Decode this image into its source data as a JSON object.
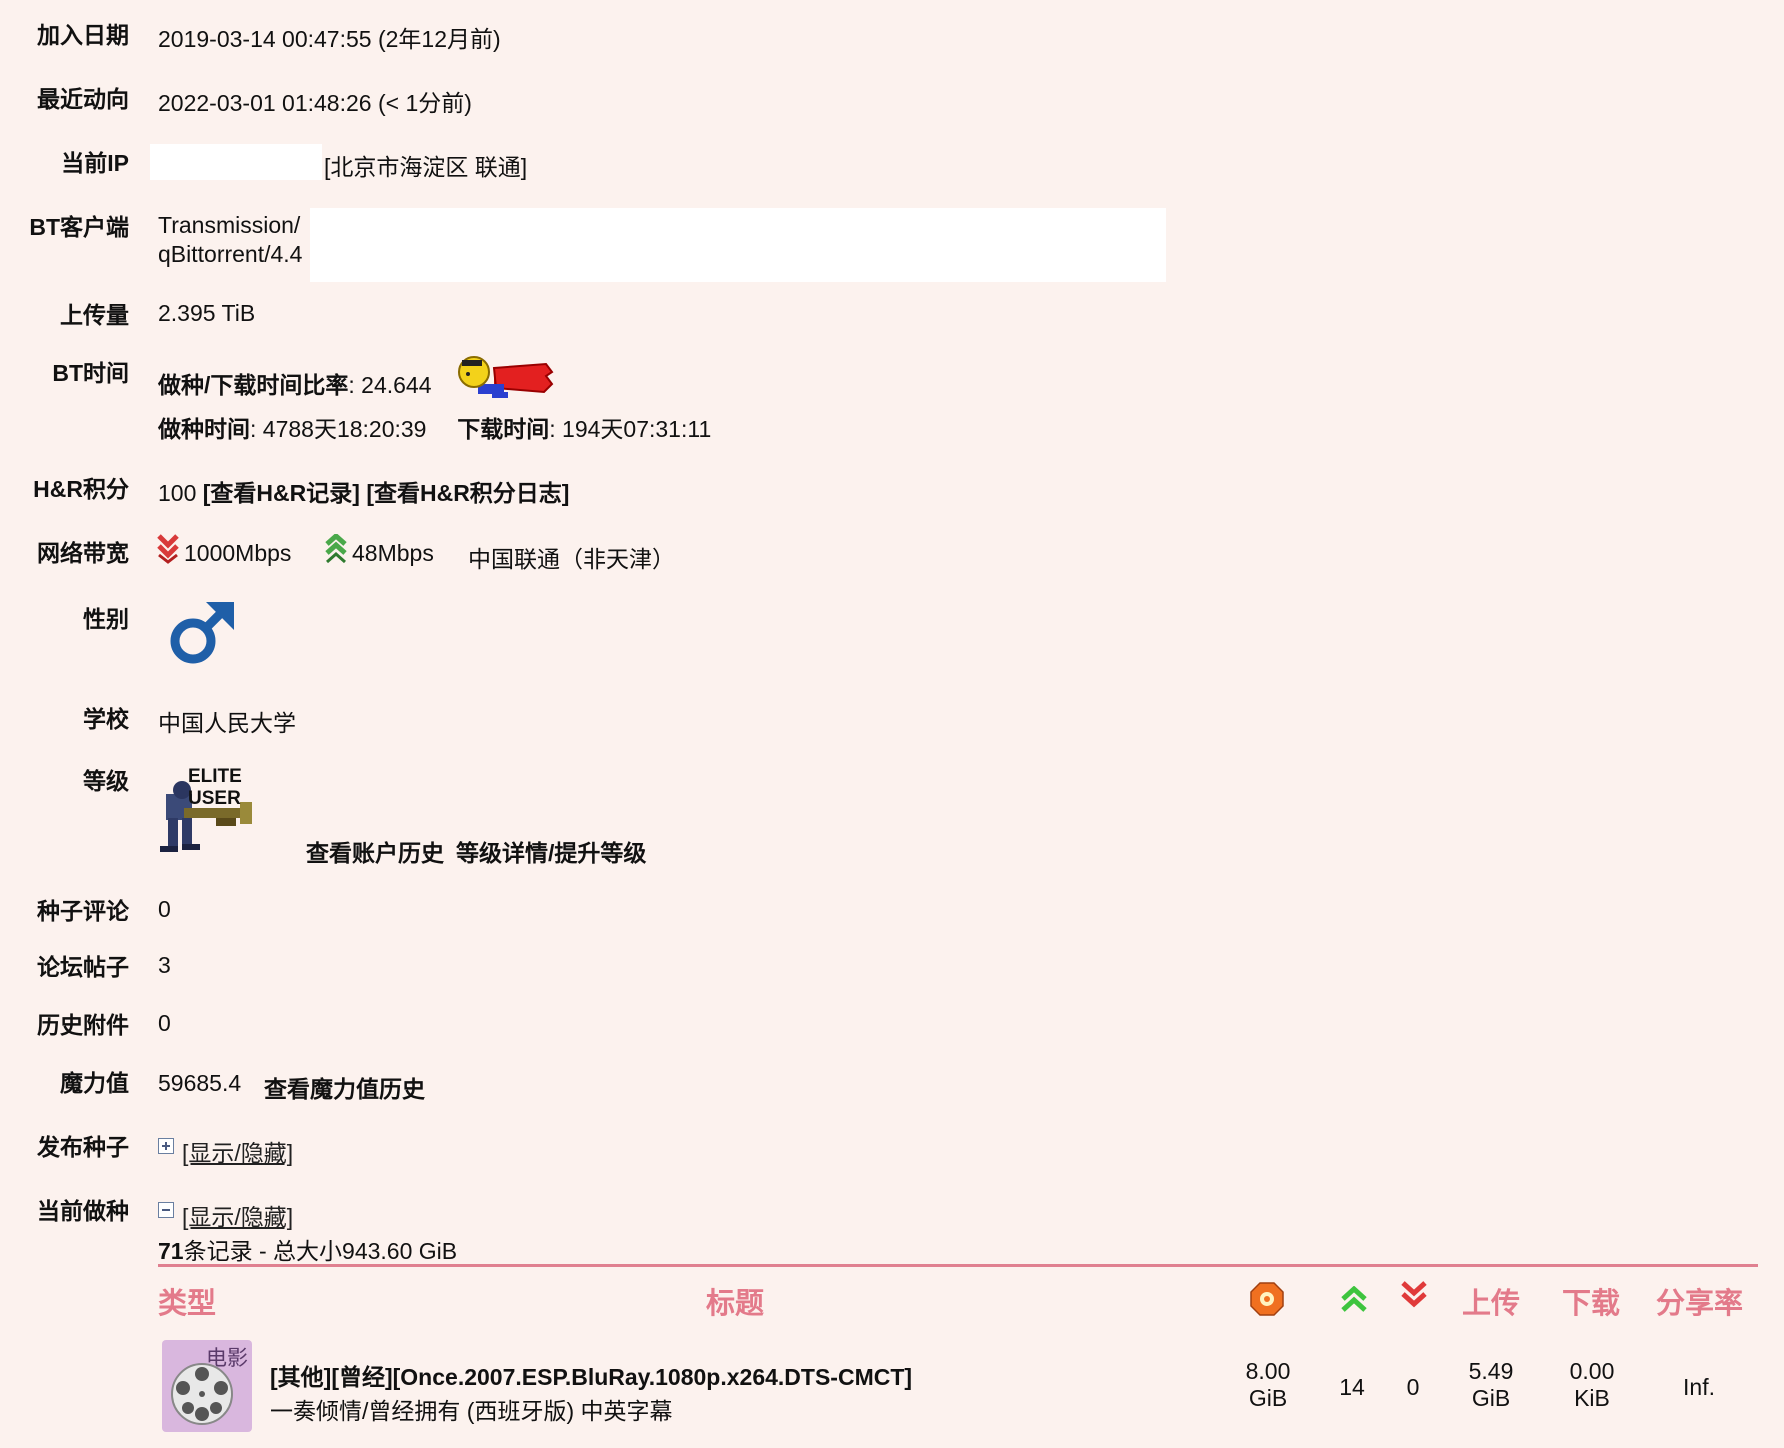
{
  "labels": {
    "join_date": "加入日期",
    "last_action": "最近动向",
    "current_ip": "当前IP",
    "bt_client": "BT客户端",
    "upload": "上传量",
    "bt_time": "BT时间",
    "hr_points": "H&R积分",
    "bandwidth": "网络带宽",
    "gender": "性别",
    "school": "学校",
    "class": "等级",
    "torrent_comments": "种子评论",
    "forum_posts": "论坛帖子",
    "history_attachments": "历史附件",
    "bonus": "魔力值",
    "uploaded_torrents": "发布种子",
    "current_seeding": "当前做种"
  },
  "values": {
    "join_date": "2019-03-14 00:47:55 (2年12月前)",
    "last_action": "2022-03-01 01:48:26 (< 1分前)",
    "ip_location": "[北京市海淀区 联通]",
    "client_line1": "Transmission/",
    "client_line2": "qBittorrent/4.4",
    "upload": "2.395 TiB",
    "seed_ratio_label": "做种/下载时间比率",
    "seed_ratio_value": ": 24.644",
    "seed_time_label": "做种时间",
    "seed_time_value": ": 4788天18:20:39",
    "download_time_label": "下载时间",
    "download_time_value": ": 194天07:31:11",
    "hr_value": "100",
    "hr_record_link": "[查看H&R记录]",
    "hr_log_link": "[查看H&R积分日志]",
    "down_speed": "1000Mbps",
    "up_speed": "48Mbps",
    "isp": "中国联通（非天津）",
    "school": "中国人民大学",
    "class_badge_line1": "ELITE",
    "class_badge_line2": "USER",
    "account_history_link": "查看账户历史",
    "class_details_link": "等级详情/提升等级",
    "torrent_comments": "0",
    "forum_posts": "3",
    "history_attachments": "0",
    "bonus": "59685.4",
    "bonus_history_link": "查看魔力值历史",
    "show_hide_1": "[显示/隐藏]",
    "show_hide_2": "[显示/隐藏]",
    "seeding_count": "71",
    "seeding_summary": "条记录 - 总大小943.60 GiB"
  },
  "table": {
    "headers": {
      "type": "类型",
      "title": "标题",
      "upload": "上传",
      "download": "下载",
      "ratio": "分享率"
    },
    "rows": [
      {
        "category": "电影",
        "title": "[其他][曾经][Once.2007.ESP.BluRay.1080p.x264.DTS-CMCT]",
        "subtitle": "一奏倾情/曾经拥有 (西班牙版) 中英字幕",
        "size_num": "8.00",
        "size_unit": "GiB",
        "seeders": "14",
        "leechers": "0",
        "uploaded_num": "5.49",
        "uploaded_unit": "GiB",
        "downloaded_num": "0.00",
        "downloaded_unit": "KiB",
        "ratio": "Inf."
      }
    ]
  },
  "colors": {
    "background": "#fcf2ee",
    "header_pink": "#e37a8a",
    "divider": "#e08090",
    "gender_blue": "#1f5fa8"
  }
}
